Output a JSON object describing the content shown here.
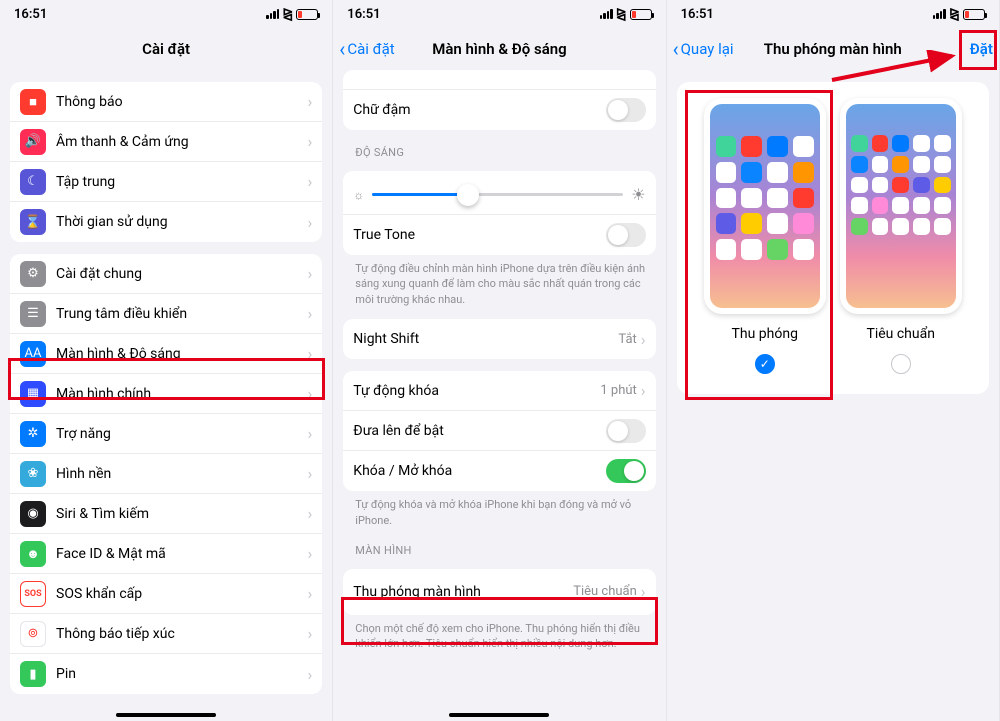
{
  "statusbar": {
    "time": "16:51"
  },
  "screen1": {
    "title": "Cài đặt",
    "group1": [
      {
        "name": "notifications",
        "label": "Thông báo",
        "iconBg": "#ff3b30",
        "glyph": "■"
      },
      {
        "name": "sound",
        "label": "Âm thanh & Cảm ứng",
        "iconBg": "#ff2d55",
        "glyph": "🔊"
      },
      {
        "name": "focus",
        "label": "Tập trung",
        "iconBg": "#5856d6",
        "glyph": "☾"
      },
      {
        "name": "screentime",
        "label": "Thời gian sử dụng",
        "iconBg": "#5856d6",
        "glyph": "⌛"
      }
    ],
    "group2": [
      {
        "name": "general",
        "label": "Cài đặt chung",
        "iconBg": "#8e8e93",
        "glyph": "⚙"
      },
      {
        "name": "controlcenter",
        "label": "Trung tâm điều khiển",
        "iconBg": "#8e8e93",
        "glyph": "☰"
      },
      {
        "name": "display",
        "label": "Màn hình & Độ sáng",
        "iconBg": "#007aff",
        "glyph": "AA"
      },
      {
        "name": "homescreen",
        "label": "Màn hình chính",
        "iconBg": "#2f4bff",
        "glyph": "▦"
      },
      {
        "name": "accessibility",
        "label": "Trợ năng",
        "iconBg": "#007aff",
        "glyph": "✲"
      },
      {
        "name": "wallpaper",
        "label": "Hình nền",
        "iconBg": "#34aadc",
        "glyph": "❀"
      },
      {
        "name": "siri",
        "label": "Siri & Tìm kiếm",
        "iconBg": "#1c1c1e",
        "glyph": "◉"
      },
      {
        "name": "faceid",
        "label": "Face ID & Mật mã",
        "iconBg": "#34c759",
        "glyph": "☻"
      },
      {
        "name": "sos",
        "label": "SOS khẩn cấp",
        "iconBg": "#ffffff",
        "glyph": "SOS"
      },
      {
        "name": "exposure",
        "label": "Thông báo tiếp xúc",
        "iconBg": "#ffffff",
        "glyph": "⊚"
      },
      {
        "name": "battery",
        "label": "Pin",
        "iconBg": "#34c759",
        "glyph": "▮"
      }
    ]
  },
  "screen2": {
    "back": "Cài đặt",
    "title": "Màn hình & Độ sáng",
    "bold_label": "Chữ đậm",
    "brightness_header": "ĐỘ SÁNG",
    "truetone_label": "True Tone",
    "truetone_footnote": "Tự động điều chỉnh màn hình iPhone dựa trên điều kiện ánh sáng xung quanh để làm cho màu sắc nhất quán trong các môi trường khác nhau.",
    "nightshift_label": "Night Shift",
    "nightshift_value": "Tắt",
    "autolock_label": "Tự động khóa",
    "autolock_value": "1 phút",
    "raise_label": "Đưa lên để bật",
    "lockunlock_label": "Khóa / Mở khóa",
    "lockunlock_footnote": "Tự động khóa và mở khóa iPhone khi bạn đóng và mở vỏ iPhone.",
    "display_header": "MÀN HÌNH",
    "zoom_label": "Thu phóng màn hình",
    "zoom_value": "Tiêu chuẩn",
    "zoom_footnote": "Chọn một chế độ xem cho iPhone. Thu phóng hiển thị điều khiển lớn hơn. Tiêu chuẩn hiển thị nhiều nội dung hơn."
  },
  "screen3": {
    "back": "Quay lại",
    "title": "Thu phóng màn hình",
    "action": "Đặt",
    "option_zoomed": "Thu phóng",
    "option_standard": "Tiêu chuẩn",
    "zoomed_icons": [
      "#41d49a",
      "#ff3b30",
      "#007aff",
      "#ffffff",
      "#ffffff",
      "#0a84ff",
      "#ffffff",
      "#ff9500",
      "#ffffff",
      "#ffffff",
      "#ffffff",
      "#ff3b30",
      "#5e5ce6",
      "#ffcc00",
      "#ffffff",
      "#ff8ad8",
      "#ffffff",
      "#ffffff",
      "#65d465",
      "#ffffff"
    ],
    "standard_icons": [
      "#41d49a",
      "#ff3b30",
      "#007aff",
      "#fff",
      "#fff",
      "#0a84ff",
      "#fff",
      "#ff9500",
      "#fff",
      "#fff",
      "#fff",
      "#fff",
      "#ff3b30",
      "#5e5ce6",
      "#ffcc00",
      "#fff",
      "#ff8ad8",
      "#fff",
      "#fff",
      "#fff",
      "#65d465",
      "#fff",
      "#fff",
      "#fff",
      "#fff"
    ]
  }
}
